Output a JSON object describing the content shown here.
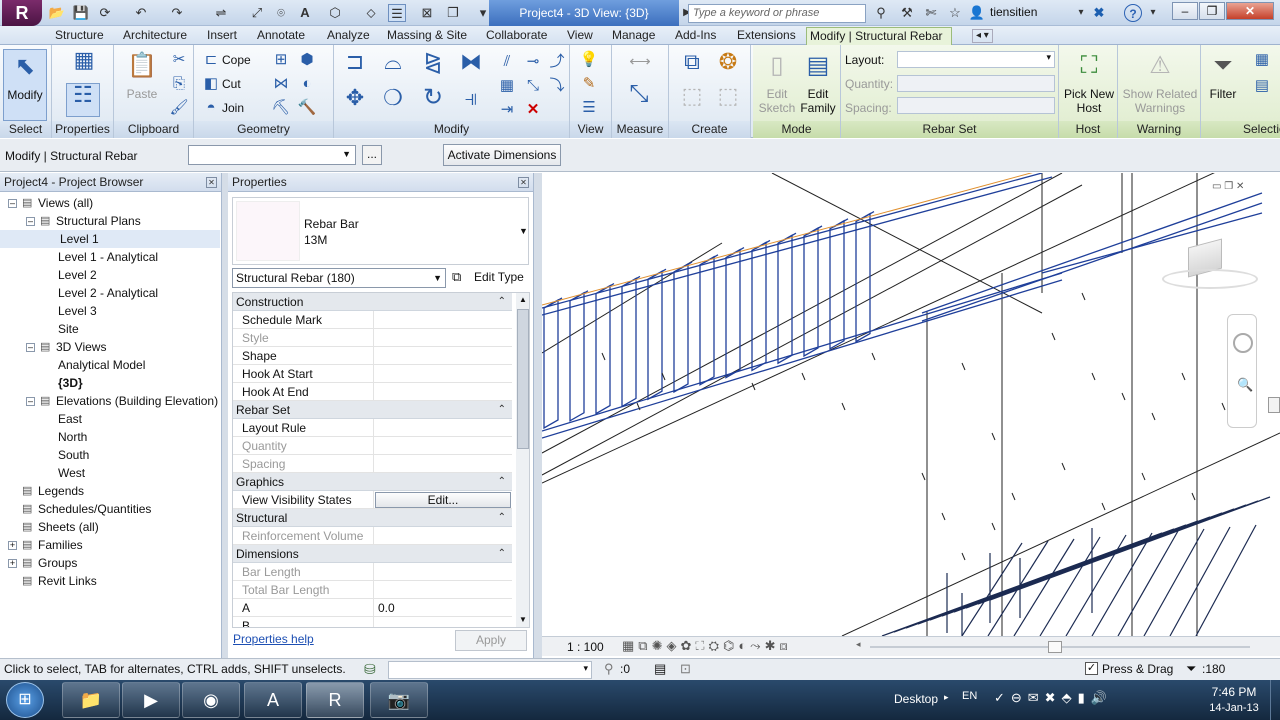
{
  "title_bar": {
    "window_title": "Project4 - 3D View: {3D}",
    "search_placeholder": "Type a keyword or phrase",
    "user": "tiensitien",
    "app_letter": "R"
  },
  "tabs": [
    "Structure",
    "Architecture",
    "Insert",
    "Annotate",
    "Analyze",
    "Massing & Site",
    "Collaborate",
    "View",
    "Manage",
    "Add-Ins",
    "Extensions",
    "Modify | Structural Rebar"
  ],
  "ribbon": {
    "modify_label": "Modify",
    "paste_label": "Paste",
    "cope_label": "Cope",
    "cut_label": "Cut",
    "join_label": "Join",
    "edit_sketch_label": "Edit Sketch",
    "edit_family_label": "Edit Family",
    "layout_label": "Layout:",
    "quantity_label": "Quantity:",
    "spacing_label": "Spacing:",
    "pick_new_host_label": "Pick New Host",
    "show_related_warnings_label": "Show Related Warnings",
    "filter_label": "Filter",
    "panels": {
      "select": "Select",
      "properties": "Properties",
      "clipboard": "Clipboard",
      "geometry": "Geometry",
      "modify": "Modify",
      "view": "View",
      "measure": "Measure",
      "create": "Create",
      "mode": "Mode",
      "rebar_set": "Rebar Set",
      "host": "Host",
      "warning": "Warning",
      "selection": "Selection"
    }
  },
  "option_bar": {
    "context": "Modify | Structural Rebar",
    "activate_dimensions": "Activate Dimensions",
    "more": "..."
  },
  "project_browser": {
    "title": "Project4 - Project Browser",
    "items": [
      {
        "label": "Views (all)",
        "level": 0,
        "expander": "−"
      },
      {
        "label": "Structural Plans",
        "level": 1,
        "expander": "−"
      },
      {
        "label": "Level 1",
        "level": 2,
        "selected": true
      },
      {
        "label": "Level 1 - Analytical",
        "level": 2
      },
      {
        "label": "Level 2",
        "level": 2
      },
      {
        "label": "Level 2 - Analytical",
        "level": 2
      },
      {
        "label": "Level 3",
        "level": 2
      },
      {
        "label": "Site",
        "level": 2
      },
      {
        "label": "3D Views",
        "level": 1,
        "expander": "−"
      },
      {
        "label": "Analytical Model",
        "level": 2
      },
      {
        "label": "{3D}",
        "level": 2,
        "bold": true
      },
      {
        "label": "Elevations (Building Elevation)",
        "level": 1,
        "expander": "−"
      },
      {
        "label": "East",
        "level": 2
      },
      {
        "label": "North",
        "level": 2
      },
      {
        "label": "South",
        "level": 2
      },
      {
        "label": "West",
        "level": 2
      },
      {
        "label": "Legends",
        "level": 0
      },
      {
        "label": "Schedules/Quantities",
        "level": 0
      },
      {
        "label": "Sheets (all)",
        "level": 0
      },
      {
        "label": "Families",
        "level": 0,
        "expander": "+"
      },
      {
        "label": "Groups",
        "level": 0,
        "expander": "+"
      },
      {
        "label": "Revit Links",
        "level": 0
      }
    ]
  },
  "properties": {
    "title": "Properties",
    "type_name": "Rebar Bar",
    "type_size": "13M",
    "instance_selector": "Structural Rebar (180)",
    "edit_type": "Edit Type",
    "help": "Properties help",
    "apply": "Apply",
    "rows": [
      {
        "kind": "group",
        "label": "Construction"
      },
      {
        "kind": "row",
        "key": "Schedule Mark",
        "value": ""
      },
      {
        "kind": "row",
        "key": "Style",
        "value": "",
        "disabled": true
      },
      {
        "kind": "row",
        "key": "Shape",
        "value": ""
      },
      {
        "kind": "row",
        "key": "Hook At Start",
        "value": ""
      },
      {
        "kind": "row",
        "key": "Hook At End",
        "value": ""
      },
      {
        "kind": "group",
        "label": "Rebar Set"
      },
      {
        "kind": "row",
        "key": "Layout Rule",
        "value": ""
      },
      {
        "kind": "row",
        "key": "Quantity",
        "value": "",
        "disabled": true
      },
      {
        "kind": "row",
        "key": "Spacing",
        "value": "",
        "disabled": true
      },
      {
        "kind": "group",
        "label": "Graphics"
      },
      {
        "kind": "row",
        "key": "View Visibility States",
        "value": "Edit...",
        "button": true
      },
      {
        "kind": "group",
        "label": "Structural"
      },
      {
        "kind": "row",
        "key": "Reinforcement Volume",
        "value": "",
        "disabled": true
      },
      {
        "kind": "group",
        "label": "Dimensions"
      },
      {
        "kind": "row",
        "key": "Bar Length",
        "value": "",
        "disabled": true
      },
      {
        "kind": "row",
        "key": "Total Bar Length",
        "value": "",
        "disabled": true
      },
      {
        "kind": "row",
        "key": "A",
        "value": "0.0"
      },
      {
        "kind": "row",
        "key": "B",
        "value": ""
      }
    ]
  },
  "view_controls": {
    "scale": "1 : 100"
  },
  "status_bar": {
    "hint": "Click to select, TAB for alternates, CTRL adds, SHIFT unselects.",
    "worksets": ":0",
    "press_drag": "Press & Drag",
    "filter_count": ":180"
  },
  "taskbar": {
    "desktop": "Desktop",
    "lang": "EN",
    "time": "7:46 PM",
    "date": "14-Jan-13"
  },
  "colors": {
    "rebar_blue": "#1f3f9a",
    "context_tab_green": "#e8f3da",
    "title_blue": "#3c6fbe"
  }
}
